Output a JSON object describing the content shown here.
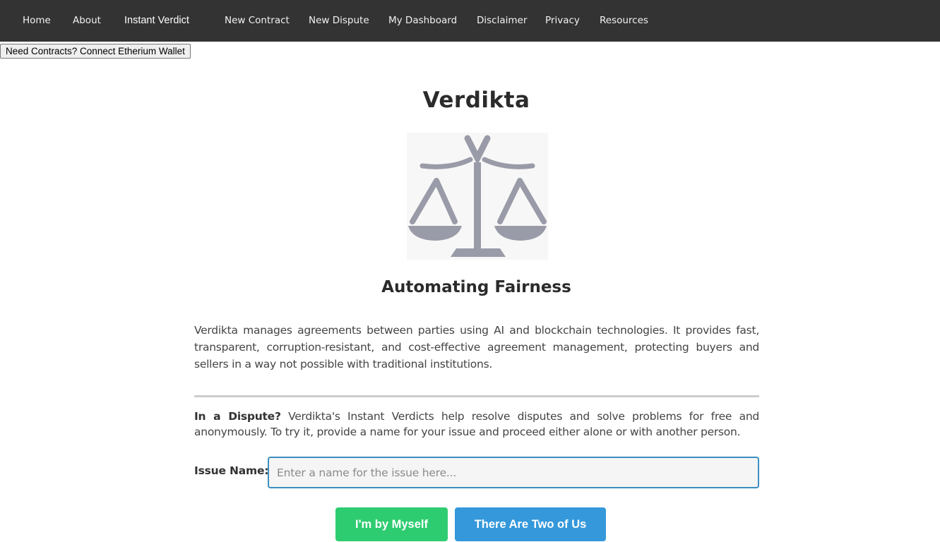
{
  "nav": {
    "items": [
      {
        "label": "Home"
      },
      {
        "label": "About"
      },
      {
        "label": "Instant Verdict"
      },
      {
        "label": "New Contract"
      },
      {
        "label": "New Dispute"
      },
      {
        "label": "My Dashboard"
      },
      {
        "label": "Disclaimer"
      },
      {
        "label": "Privacy"
      },
      {
        "label": "Resources"
      }
    ]
  },
  "wallet_button": {
    "label": "Need Contracts? Connect Etherium Wallet"
  },
  "hero": {
    "title": "Verdikta",
    "logo_icon": "scales-of-justice-icon",
    "subtitle": "Automating Fairness",
    "intro": "Verdikta manages agreements between parties using AI and blockchain technologies. It provides fast, transparent, corruption-resistant, and cost-effective agreement management, protecting buyers and sellers in a way not possible with traditional institutions."
  },
  "dispute": {
    "lead": "In a Dispute?",
    "text": " Verdikta's Instant Verdicts help resolve disputes and solve problems for free and anonymously. To try it, provide a name for your issue and proceed either alone or with another person.",
    "issue_label": "Issue Name:",
    "issue_value": "",
    "issue_placeholder": "Enter a name for the issue here...",
    "buttons": {
      "myself": "I'm by Myself",
      "two": "There Are Two of Us"
    }
  },
  "colors": {
    "navbar_bg": "#333333",
    "green": "#2ecc71",
    "blue": "#3498db",
    "input_border": "#3d8fc0",
    "logo_gray": "#9a9ba8"
  }
}
